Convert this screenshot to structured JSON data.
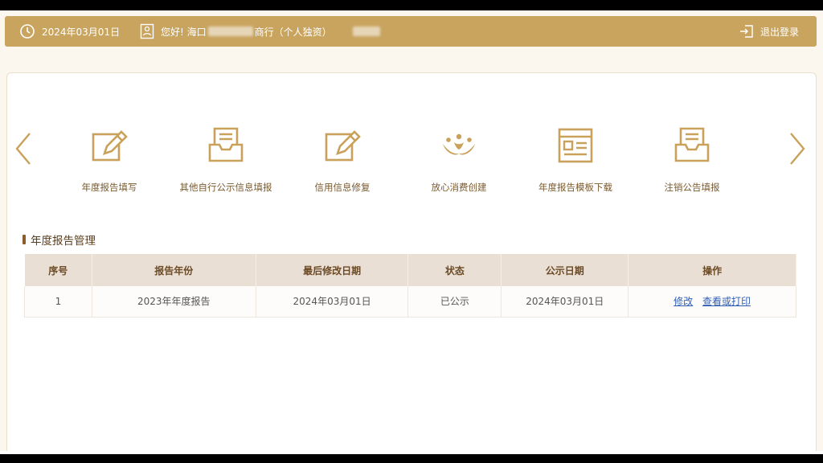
{
  "header": {
    "date": "2024年03月01日",
    "greeting_prefix": "您好! 海口",
    "greeting_suffix": "商行（个人独资）",
    "logout_label": "退出登录"
  },
  "nav": {
    "items": [
      {
        "label": "年度报告填写",
        "icon": "edit-document-icon"
      },
      {
        "label": "其他自行公示信息填报",
        "icon": "inbox-document-icon"
      },
      {
        "label": "信用信息修复",
        "icon": "edit-document-icon"
      },
      {
        "label": "放心消费创建",
        "icon": "people-logo-icon"
      },
      {
        "label": "年度报告模板下载",
        "icon": "template-window-icon"
      },
      {
        "label": "注销公告填报",
        "icon": "inbox-document-icon"
      }
    ]
  },
  "section": {
    "title": "年度报告管理"
  },
  "table": {
    "headers": [
      "序号",
      "报告年份",
      "最后修改日期",
      "状态",
      "公示日期",
      "操作"
    ],
    "rows": [
      {
        "index": "1",
        "year": "2023年年度报告",
        "modified": "2024年03月01日",
        "status": "已公示",
        "publish_date": "2024年03月01日",
        "action_edit": "修改",
        "action_view": "查看或打印"
      }
    ]
  },
  "colors": {
    "accent": "#c8a45f",
    "icon_gold": "#c9a15a"
  }
}
